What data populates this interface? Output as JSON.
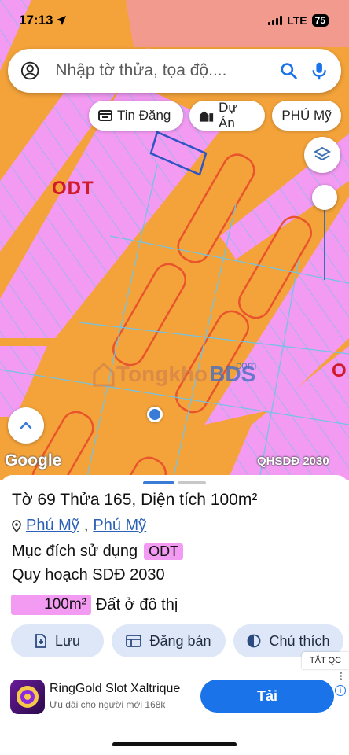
{
  "status_bar": {
    "time": "17:13",
    "network": "LTE",
    "battery": "75"
  },
  "search": {
    "placeholder": "Nhập tờ thửa, tọa độ...."
  },
  "chips": [
    {
      "label": "Tin Đăng",
      "icon": "listing-icon"
    },
    {
      "label": "Dự Án",
      "icon": "buildings-icon"
    },
    {
      "label": "PHÚ Mỹ",
      "icon": ""
    }
  ],
  "map": {
    "zone_labels": [
      "ODT",
      "O"
    ],
    "watermark": {
      "part_a": "Tongkho",
      "part_b": "BDS",
      "part_c": "com"
    },
    "google_logo": "Google",
    "layer_tag": "QHSDĐ 2030",
    "colors": {
      "residential": "#f39af3",
      "road": "#f4a33a",
      "grid": "#6fc3e6",
      "border": "#e8542b"
    }
  },
  "parcel": {
    "sheet_label": "Tờ",
    "sheet_no": "69",
    "plot_label": "Thửa",
    "plot_no": "165",
    "area_label": "Diện tích",
    "area": "100m²",
    "ward": "Phú Mỹ",
    "district": "Phú Mỹ",
    "purpose_label": "Mục đích sử dụng",
    "purpose_code": "ODT",
    "plan_label": "Quy hoạch SDĐ 2030",
    "plan_area": "100m²",
    "plan_desc": "Đất ở đô thị"
  },
  "actions": [
    {
      "label": "Lưu",
      "icon": "save-add-icon"
    },
    {
      "label": "Đăng bán",
      "icon": "list-post-icon"
    },
    {
      "label": "Chú thích",
      "icon": "legend-icon"
    }
  ],
  "ad": {
    "close_label": "TẮT QC",
    "title": "RingGold Slot Xaltrique",
    "subtitle": "Ưu đãi cho người mới 168k",
    "cta": "Tải",
    "info": "i"
  }
}
